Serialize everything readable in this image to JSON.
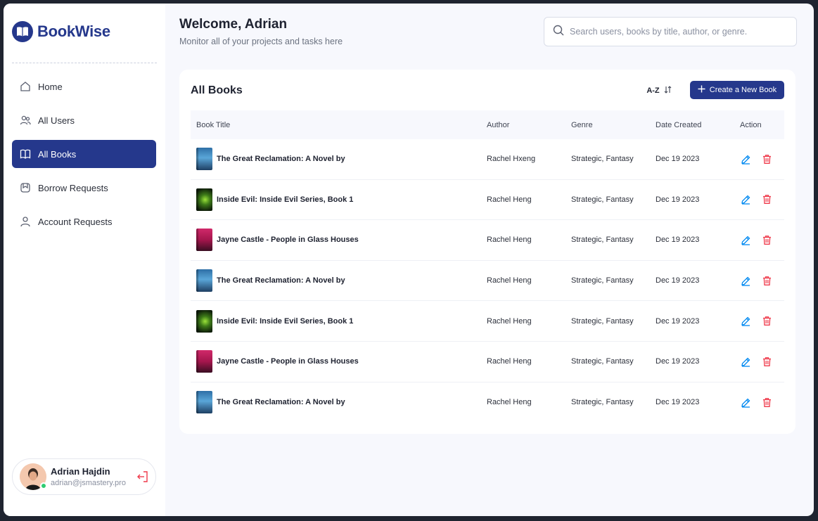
{
  "app": {
    "name": "BookWise"
  },
  "sidebar": {
    "items": [
      {
        "label": "Home",
        "icon": "home-icon",
        "active": false
      },
      {
        "label": "All Users",
        "icon": "users-icon",
        "active": false
      },
      {
        "label": "All Books",
        "icon": "book-icon",
        "active": true
      },
      {
        "label": "Borrow Requests",
        "icon": "bookmark-icon",
        "active": false
      },
      {
        "label": "Account Requests",
        "icon": "user-icon",
        "active": false
      }
    ]
  },
  "user": {
    "name": "Adrian Hajdin",
    "email": "adrian@jsmastery.pro",
    "status": "online"
  },
  "header": {
    "welcome": "Welcome, Adrian",
    "subtitle": "Monitor all of your projects and tasks here"
  },
  "search": {
    "placeholder": "Search users, books by title, author, or genre.",
    "value": ""
  },
  "panel": {
    "title": "All Books",
    "sort_label": "A-Z",
    "create_label": "Create a New Book"
  },
  "table": {
    "columns": [
      "Book Title",
      "Author",
      "Genre",
      "Date Created",
      "Action"
    ],
    "rows": [
      {
        "title": "The Great Reclamation: A Novel by",
        "author": "Rachel Hxeng",
        "genre": "Strategic, Fantasy",
        "date": "Dec 19 2023",
        "cover": "blue"
      },
      {
        "title": "Inside Evil: Inside Evil Series, Book 1",
        "author": "Rachel Heng",
        "genre": "Strategic, Fantasy",
        "date": "Dec 19 2023",
        "cover": "green"
      },
      {
        "title": "Jayne Castle - People in Glass Houses",
        "author": "Rachel Heng",
        "genre": "Strategic, Fantasy",
        "date": "Dec 19 2023",
        "cover": "pink"
      },
      {
        "title": "The Great Reclamation: A Novel by",
        "author": "Rachel Heng",
        "genre": "Strategic, Fantasy",
        "date": "Dec 19 2023",
        "cover": "blue"
      },
      {
        "title": "Inside Evil: Inside Evil Series, Book 1",
        "author": "Rachel Heng",
        "genre": "Strategic, Fantasy",
        "date": "Dec 19 2023",
        "cover": "green"
      },
      {
        "title": "Jayne Castle - People in Glass Houses",
        "author": "Rachel Heng",
        "genre": "Strategic, Fantasy",
        "date": "Dec 19 2023",
        "cover": "pink"
      },
      {
        "title": "The Great Reclamation: A Novel by",
        "author": "Rachel Heng",
        "genre": "Strategic, Fantasy",
        "date": "Dec 19 2023",
        "cover": "blue"
      }
    ]
  },
  "colors": {
    "primary": "#25388c",
    "edit": "#0089f1",
    "delete": "#ef3a4b",
    "online": "#2ecc71"
  }
}
